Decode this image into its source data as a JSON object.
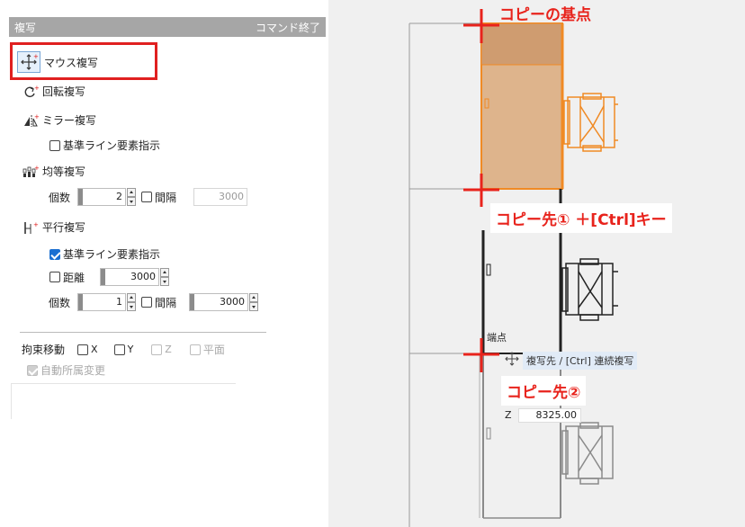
{
  "panel": {
    "title": "複写",
    "end_command": "コマンド終了",
    "mouse_copy": "マウス複写",
    "rotate_copy": "回転複写",
    "mirror_copy": "ミラー複写",
    "mirror_ref_line": "基準ライン要素指示",
    "equal_copy": "均等複写",
    "equal_count_label": "個数",
    "equal_count": "2",
    "equal_interval_label": "間隔",
    "equal_interval": "3000",
    "parallel_copy": "平行複写",
    "parallel_ref_line": "基準ライン要素指示",
    "distance_label": "距離",
    "distance": "3000",
    "parallel_count_label": "個数",
    "parallel_count": "1",
    "parallel_interval_label": "間隔",
    "parallel_interval": "3000",
    "constraint_label": "拘束移動",
    "axis_x": "X",
    "axis_y": "Y",
    "axis_z": "Z",
    "axis_plane": "平面",
    "auto_affiliation": "自動所属変更"
  },
  "viewport": {
    "callout_base": "コピーの基点",
    "callout_dest1": "コピー先① ＋[Ctrl]キー",
    "callout_dest2": "コピー先②",
    "endpoint_tag": "端点",
    "hint_text": "複写先  / [Ctrl] 連続複写",
    "coord_axis": "Z",
    "coord_value": "8325.00"
  },
  "colors": {
    "highlight_red": "#e02020",
    "accent_blue": "#1a6fd1",
    "object_orange": "#f08a24",
    "object_fill": "#deb48c"
  }
}
